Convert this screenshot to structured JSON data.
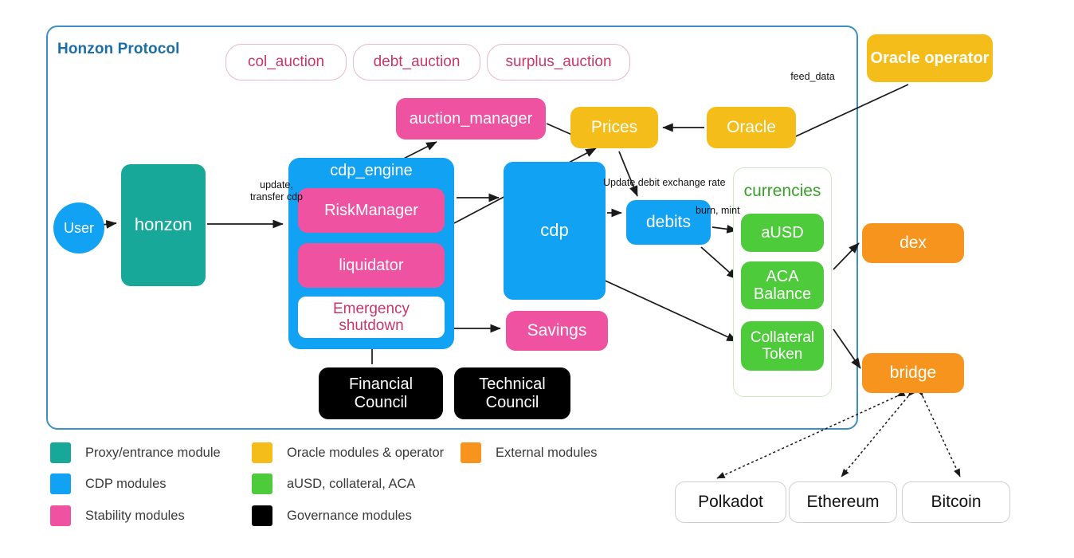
{
  "diagram": {
    "title": "Honzon Protocol",
    "frame_color": "#3d8fc4"
  },
  "auction_pills": [
    {
      "label": "col_auction"
    },
    {
      "label": "debt_auction"
    },
    {
      "label": "surplus_auction"
    }
  ],
  "nodes": {
    "user": "User",
    "honzon": "honzon",
    "cdp_engine": "cdp_engine",
    "risk_manager": "RiskManager",
    "liquidator": "liquidator",
    "emergency_shutdown": "Emergency\nshutdown",
    "auction_manager": "auction_manager",
    "prices": "Prices",
    "oracle": "Oracle",
    "oracle_operator": "Oracle operator",
    "cdp": "cdp",
    "debits": "debits",
    "savings": "Savings",
    "financial_council": "Financial\nCouncil",
    "technical_council": "Technical\nCouncil",
    "currencies_group": "currencies",
    "ausd": "aUSD",
    "aca_balance": "ACA\nBalance",
    "collateral_token": "Collateral\nToken",
    "dex": "dex",
    "bridge": "bridge",
    "polkadot": "Polkadot",
    "ethereum": "Ethereum",
    "bitcoin": "Bitcoin"
  },
  "edge_labels": {
    "update_transfer_cdp": "update,\ntransfer cdp",
    "feed_data": "feed_data",
    "update_debit_exchange_rate": "Update debit exchange rate",
    "burn_mint": "burn, mint"
  },
  "legend": [
    {
      "label": "Proxy/entrance module",
      "color": "#17a89a"
    },
    {
      "label": "CDP modules",
      "color": "#11a2f3"
    },
    {
      "label": "Stability modules",
      "color": "#ef52a0"
    },
    {
      "label": "Oracle modules & operator",
      "color": "#f5bd19"
    },
    {
      "label": "aUSD, collateral, ACA",
      "color": "#4ecb3a"
    },
    {
      "label": "Governance modules",
      "color": "#000000"
    },
    {
      "label": "External modules",
      "color": "#f7941d"
    }
  ]
}
